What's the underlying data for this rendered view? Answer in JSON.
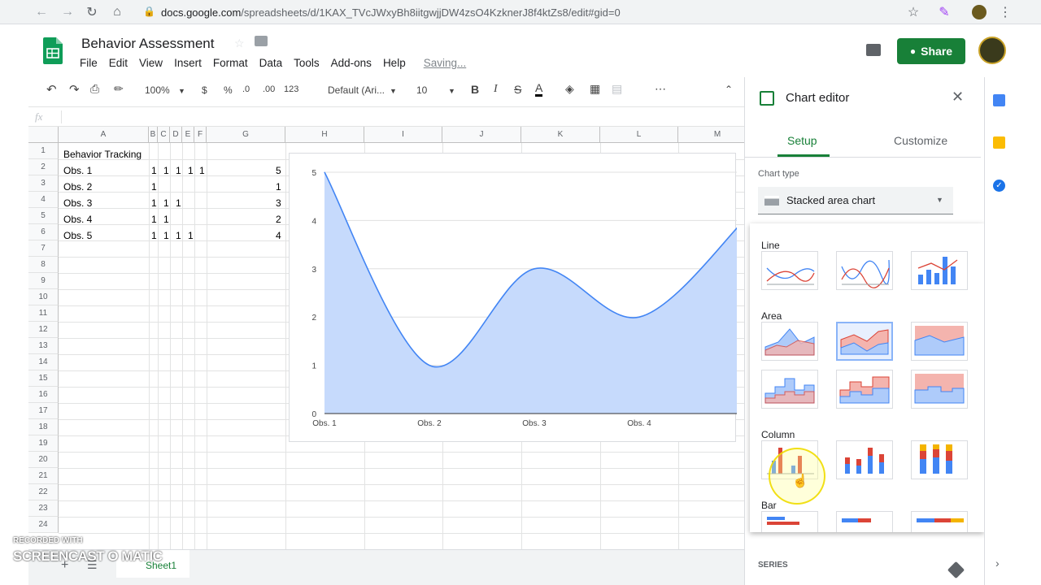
{
  "browser": {
    "url_host": "docs.google.com",
    "url_path": "/spreadsheets/d/1KAX_TVcJWxyBh8iitgwjjDW4zsO4KzknerJ8f4ktZs8/edit#gid=0"
  },
  "header": {
    "title": "Behavior Assessment",
    "menu": [
      "File",
      "Edit",
      "View",
      "Insert",
      "Format",
      "Data",
      "Tools",
      "Add-ons",
      "Help"
    ],
    "saving": "Saving...",
    "share_label": "Share"
  },
  "toolbar": {
    "zoom": "100%",
    "currency": "$",
    "percent": "%",
    "decimal_less": ".0",
    "decimal_more": ".00",
    "format_more": "123",
    "font": "Default (Ari...",
    "font_size": "10",
    "bold": "B",
    "italic": "I",
    "strike": "S",
    "text_color": "A"
  },
  "formula_bar": {
    "fx": "fx"
  },
  "grid": {
    "columns": [
      "A",
      "B",
      "C",
      "D",
      "E",
      "F",
      "G",
      "H",
      "I",
      "J",
      "K",
      "L",
      "M"
    ],
    "rows": [
      "1",
      "2",
      "3",
      "4",
      "5",
      "6",
      "7",
      "8",
      "9",
      "10",
      "11",
      "12",
      "13",
      "14",
      "15",
      "16",
      "17",
      "18",
      "19",
      "20",
      "21",
      "22",
      "23",
      "24"
    ],
    "cells": {
      "A1": "Behavior Tracking",
      "A2": "Obs. 1",
      "A3": "Obs. 2",
      "A4": "Obs. 3",
      "A5": "Obs. 4",
      "A6": "Obs. 5",
      "B2": "1",
      "C2": "1",
      "D2": "1",
      "E2": "1",
      "F2": "1",
      "G2": "5",
      "B3": "1",
      "G3": "1",
      "B4": "1",
      "C4": "1",
      "D4": "1",
      "G4": "3",
      "B5": "1",
      "C5": "1",
      "G5": "2",
      "B6": "1",
      "C6": "1",
      "D6": "1",
      "E6": "1",
      "G6": "4"
    }
  },
  "chart_data": {
    "type": "area",
    "categories": [
      "Obs. 1",
      "Obs. 2",
      "Obs. 3",
      "Obs. 4",
      "O"
    ],
    "values": [
      5,
      1,
      3,
      2,
      4
    ],
    "ylim": [
      0,
      5
    ],
    "yticks": [
      "0",
      "1",
      "2",
      "3",
      "4",
      "5"
    ],
    "fill_color": "#c6dafc",
    "line_color": "#4285f4",
    "grid": true
  },
  "chart_editor": {
    "title": "Chart editor",
    "tab_setup": "Setup",
    "tab_customize": "Customize",
    "chart_type_label": "Chart type",
    "chart_type_value": "Stacked area chart",
    "groups": [
      "Line",
      "Area",
      "Column",
      "Bar"
    ],
    "series_label": "SERIES"
  },
  "watermark": {
    "small": "RECORDED WITH",
    "big": "SCREENCAST O MATIC"
  },
  "sheet_tab": "Sheet1",
  "colors": {
    "accent": "#188038",
    "chart_blue": "#4285f4",
    "chart_red": "#db4437"
  }
}
